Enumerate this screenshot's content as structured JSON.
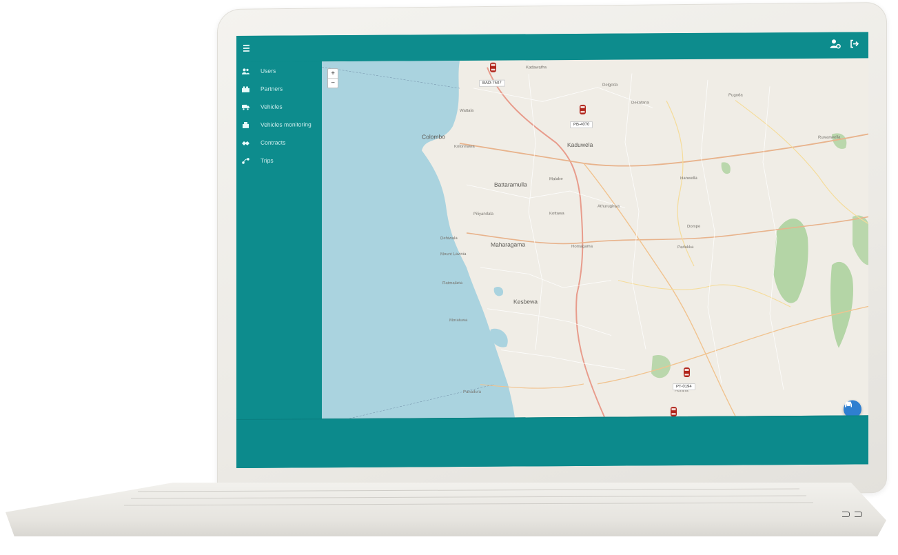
{
  "app": {
    "accent_color": "#0d8c8d",
    "fab_color": "#2f7fd0"
  },
  "header": {
    "menu_icon": "hamburger-icon",
    "actions": [
      {
        "icon": "user-settings-icon"
      },
      {
        "icon": "logout-icon"
      }
    ]
  },
  "sidebar": {
    "items": [
      {
        "label": "Users",
        "icon": "users-icon"
      },
      {
        "label": "Partners",
        "icon": "partners-icon"
      },
      {
        "label": "Vehicles",
        "icon": "truck-icon"
      },
      {
        "label": "Vehicles monitoring",
        "icon": "monitoring-icon"
      },
      {
        "label": "Contracts",
        "icon": "contracts-icon"
      },
      {
        "label": "Trips",
        "icon": "trips-icon"
      }
    ]
  },
  "map": {
    "zoom_in": "+",
    "zoom_out": "−",
    "places": [
      "Colombo",
      "Kolonnawa",
      "Battaramulla",
      "Maharagama",
      "Dehiwala",
      "Mount Lavinia",
      "Kesbewa",
      "Moratuwa",
      "Panadura",
      "Kaduwela",
      "Malabe",
      "Homagama",
      "Padukka",
      "Dompe",
      "Wattala",
      "Delgoda",
      "Dekatana",
      "Kadawatha",
      "Horana",
      "Pugoda",
      "Ruwanwella",
      "Ratmalana",
      "Piliyandala",
      "Kottawa",
      "Athurugiriya",
      "Hanwella"
    ],
    "vehicles": [
      {
        "plate": "BAD-7507"
      },
      {
        "plate": "PB-4070"
      },
      {
        "plate": "PT-0194"
      },
      {
        "plate": ""
      }
    ]
  }
}
